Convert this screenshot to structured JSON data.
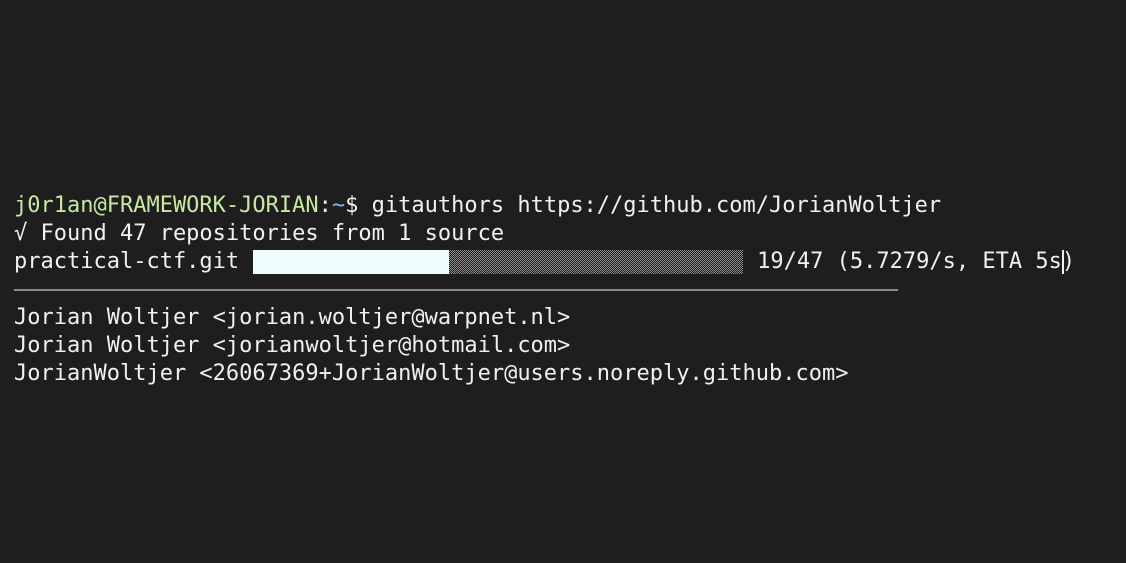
{
  "prompt": {
    "user_host": "j0r1an@FRAMEWORK-JORIAN",
    "separator": ":",
    "path": "~",
    "symbol": "$",
    "command": " gitauthors https://github.com/JorianWoltjer"
  },
  "found_line": "√ Found 47 repositories from 1 source",
  "progress": {
    "repo": "practical-ctf.git",
    "current": 19,
    "total": 47,
    "fraction": 0.4,
    "stats_before_cursor": "19/47 (5.7279/s, ETA 5s",
    "stats_after_cursor": ")"
  },
  "authors": [
    "Jorian Woltjer <jorian.woltjer@warpnet.nl>",
    "Jorian Woltjer <jorianwoltjer@hotmail.com>",
    "JorianWoltjer <26067369+JorianWoltjer@users.noreply.github.com>"
  ],
  "colors": {
    "background": "#1e1e1e",
    "user_host": "#c7e9a1",
    "path": "#79b8ff",
    "progress_fill": "#eefdfd",
    "separator": "#8a8a8a"
  }
}
